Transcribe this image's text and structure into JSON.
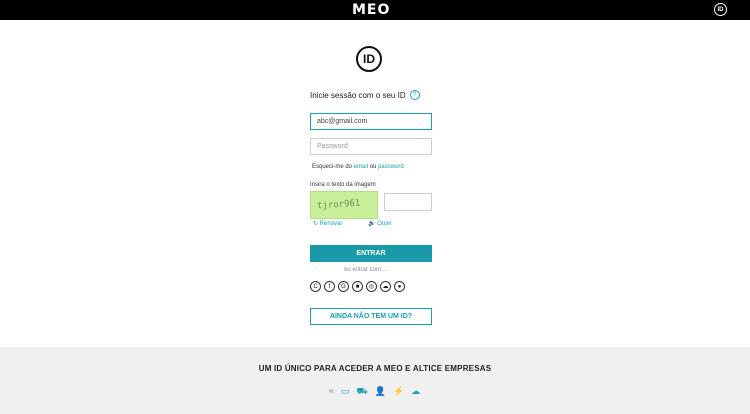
{
  "header": {
    "brand": "MEO",
    "id_icon": "ID"
  },
  "main": {
    "logo_icon": "ID",
    "title": "Inicie sessão com o seu ID",
    "help_icon": "?",
    "email": {
      "value": "abc@gmail.com"
    },
    "password": {
      "placeholder": "Password"
    },
    "forgot": {
      "prefix": "Esqueci-me do",
      "email_link": "email",
      "connector": "ou",
      "password_link": "password"
    },
    "captcha": {
      "label": "Insira o texto da imagem",
      "text": "tjror961",
      "refresh_label": "Renovar",
      "listen_label": "Ouvir"
    },
    "submit_label": "ENTRAR",
    "or_label": "ou entrar com…",
    "social_icons": [
      "C",
      "f",
      "G",
      "■",
      "◎",
      "☁",
      "●"
    ],
    "signup_label": "AINDA NÃO TEM UM ID?"
  },
  "footer": {
    "title": "UM ID ÚNICO PARA ACEDER A MEO E ALTICE EMPRESAS",
    "icons": [
      "≈",
      "▭",
      "⛟",
      "👤",
      "⚡",
      "☁"
    ]
  }
}
